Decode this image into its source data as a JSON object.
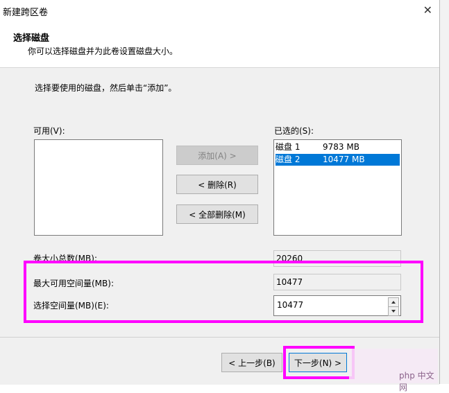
{
  "window": {
    "title": "新建跨区卷",
    "close_glyph": "✕"
  },
  "header": {
    "title": "选择磁盘",
    "subtitle": "你可以选择磁盘并为此卷设置磁盘大小。"
  },
  "instruction": "选择要使用的磁盘，然后单击“添加”。",
  "available": {
    "label": "可用(V):",
    "items": []
  },
  "selected": {
    "label": "已选的(S):",
    "items": [
      {
        "name": "磁盘 1",
        "size": "9783 MB",
        "selected": false
      },
      {
        "name": "磁盘 2",
        "size": "10477 MB",
        "selected": true
      }
    ]
  },
  "buttons": {
    "add": "添加(A) >",
    "remove": "< 删除(R)",
    "remove_all": "< 全部删除(M)",
    "back": "< 上一步(B)",
    "next": "下一步(N) >"
  },
  "fields": {
    "total_label": "卷大小总数(MB):",
    "total_value": "20260",
    "max_label": "最大可用空间量(MB):",
    "max_value": "10477",
    "choose_label": "选择空间量(MB)(E):",
    "choose_value": "10477"
  },
  "watermark": "php 中文网",
  "colors": {
    "highlight": "#ff00ff",
    "selection": "#0078d7"
  }
}
